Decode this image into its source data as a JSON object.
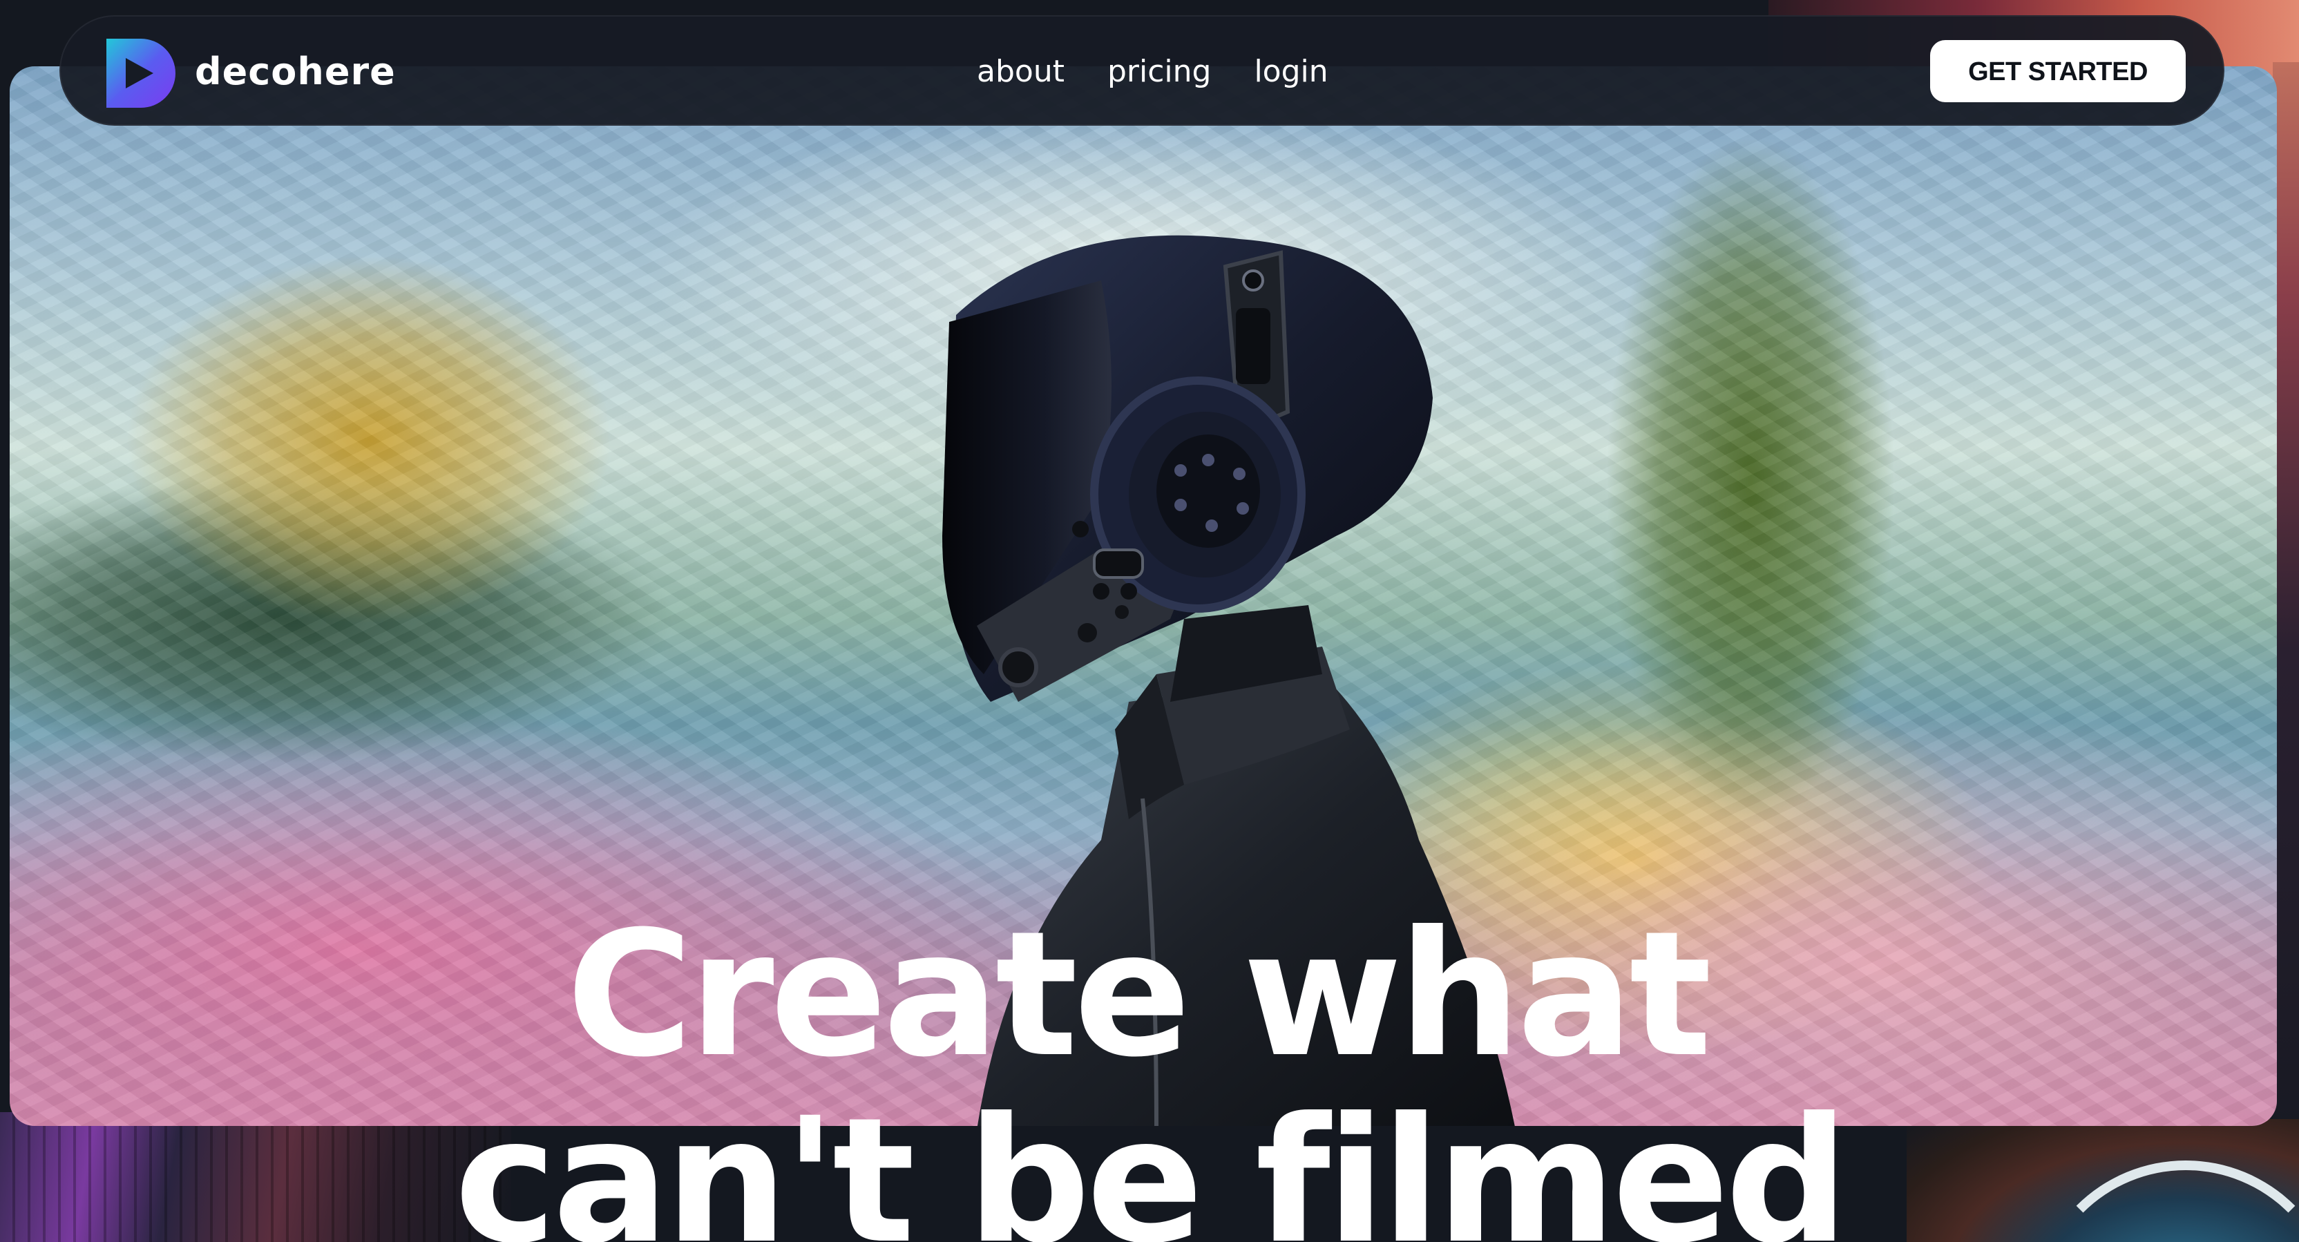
{
  "brand": {
    "name": "decohere",
    "logo_icon": "play-d-logo-icon",
    "gradient_colors": [
      "#22c8d8",
      "#5a5cf0",
      "#7b3cf0"
    ]
  },
  "nav": {
    "links": [
      {
        "label": "about"
      },
      {
        "label": "pricing"
      },
      {
        "label": "login"
      }
    ],
    "cta_label": "GET STARTED"
  },
  "hero": {
    "headline_line1": "Create what",
    "headline_line2": "can't be filmed"
  },
  "colors": {
    "page_background": "#141820",
    "nav_background": "#161b24",
    "cta_background": "#ffffff",
    "cta_text": "#0f131a",
    "text": "#ffffff"
  }
}
